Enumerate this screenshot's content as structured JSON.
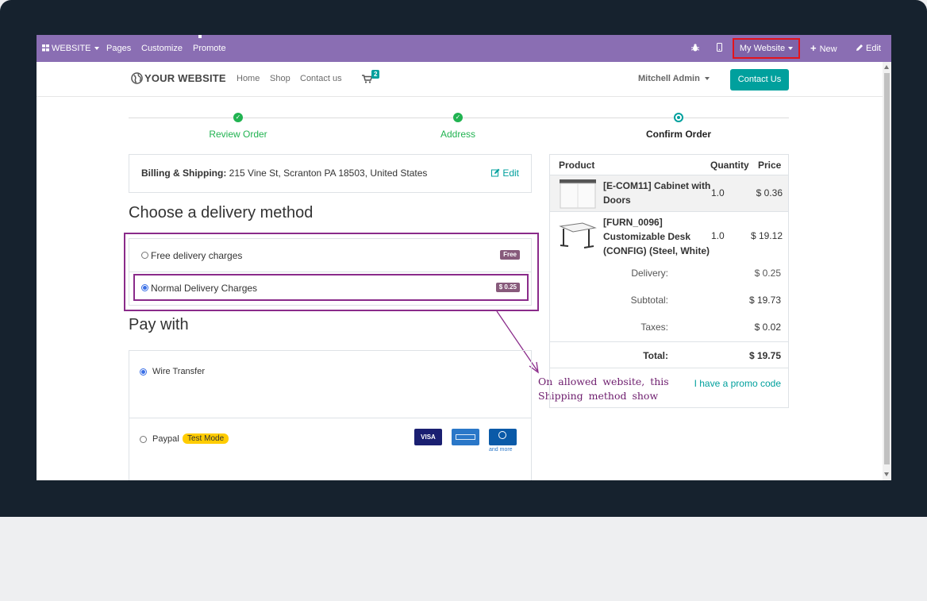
{
  "admin_bar": {
    "website_menu": "WEBSITE",
    "pages": "Pages",
    "customize": "Customize",
    "promote": "Promote",
    "my_website": "My Website",
    "new": "New",
    "edit": "Edit"
  },
  "header": {
    "logo": "YOUR WEBSITE",
    "nav": [
      "Home",
      "Shop",
      "Contact us"
    ],
    "cart_count": "2",
    "user": "Mitchell Admin",
    "contact_button": "Contact Us"
  },
  "progress": {
    "steps": [
      "Review Order",
      "Address",
      "Confirm Order"
    ]
  },
  "billing": {
    "label": "Billing & Shipping:",
    "address": "215 Vine St, Scranton PA 18503, United States",
    "edit": "Edit"
  },
  "delivery": {
    "heading": "Choose a delivery method",
    "options": [
      {
        "label": "Free delivery charges",
        "badge": "Free",
        "selected": false
      },
      {
        "label": "Normal Delivery Charges",
        "badge": "$ 0.25",
        "selected": true
      }
    ]
  },
  "payment": {
    "heading": "Pay with",
    "methods": [
      {
        "label": "Wire Transfer",
        "selected": true
      },
      {
        "label": "Paypal",
        "badge": "Test Mode",
        "selected": false
      }
    ],
    "cards": [
      "VISA",
      "and more"
    ]
  },
  "summary": {
    "headers": {
      "product": "Product",
      "quantity": "Quantity",
      "price": "Price"
    },
    "lines": [
      {
        "name_l1": "[E-COM11] Cabinet with",
        "name_l2": "Doors",
        "qty": "1.0",
        "price": "$ 0.36"
      },
      {
        "name_l1": "[FURN_0096]",
        "name_l2": "Customizable Desk",
        "name_l3": "(CONFIG) (Steel, White)",
        "qty": "1.0",
        "price": "$ 19.12"
      }
    ],
    "delivery_label": "Delivery:",
    "delivery_value": "$ 0.25",
    "subtotal_label": "Subtotal:",
    "subtotal_value": "$ 19.73",
    "taxes_label": "Taxes:",
    "taxes_value": "$ 0.02",
    "total_label": "Total:",
    "total_value": "$ 19.75",
    "promo": "I have a promo code"
  },
  "annotation": {
    "line1": "On allowed website, this",
    "line2": "Shipping method show"
  },
  "colors": {
    "admin_bar": "#8a6eb3",
    "accent": "#00a09d",
    "success": "#21b351",
    "annotation": "#8a2b8a",
    "highlight_red": "#e3141c"
  }
}
